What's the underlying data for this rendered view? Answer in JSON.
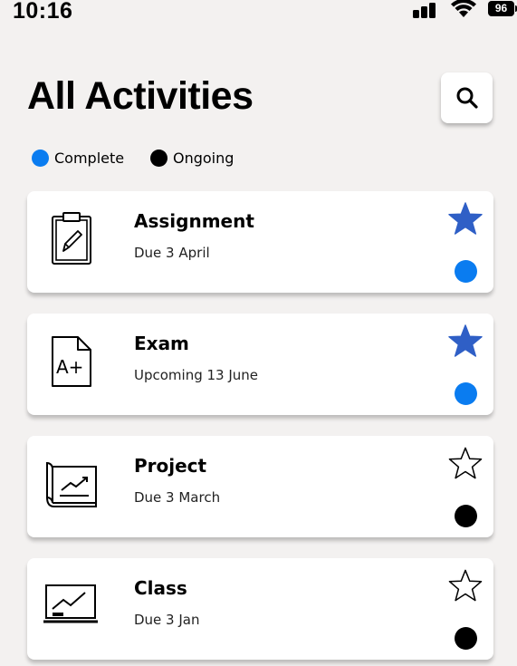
{
  "status_bar": {
    "time": "10:16",
    "battery": "96"
  },
  "header": {
    "title": "All Activities",
    "search_icon": "search-icon"
  },
  "legend": {
    "items": [
      {
        "label": "Complete",
        "color": "#0a7cf0"
      },
      {
        "label": "Ongoing",
        "color": "#000000"
      }
    ]
  },
  "activities": [
    {
      "title": "Assignment",
      "subtitle": "Due 3 April",
      "icon": "clipboard-icon",
      "starred": true,
      "status": "Complete",
      "status_color": "#0a7cf0"
    },
    {
      "title": "Exam",
      "subtitle": "Upcoming 13 June",
      "icon": "exam-grade-icon",
      "starred": true,
      "status": "Complete",
      "status_color": "#0a7cf0"
    },
    {
      "title": "Project",
      "subtitle": "Due 3 March",
      "icon": "project-chart-icon",
      "starred": false,
      "status": "Ongoing",
      "status_color": "#000000"
    },
    {
      "title": "Class",
      "subtitle": "Due 3 Jan",
      "icon": "blackboard-icon",
      "starred": false,
      "status": "Ongoing",
      "status_color": "#000000"
    }
  ],
  "colors": {
    "star_filled": "#2f5fc6",
    "background": "#f3f1f0",
    "card": "#ffffff"
  }
}
